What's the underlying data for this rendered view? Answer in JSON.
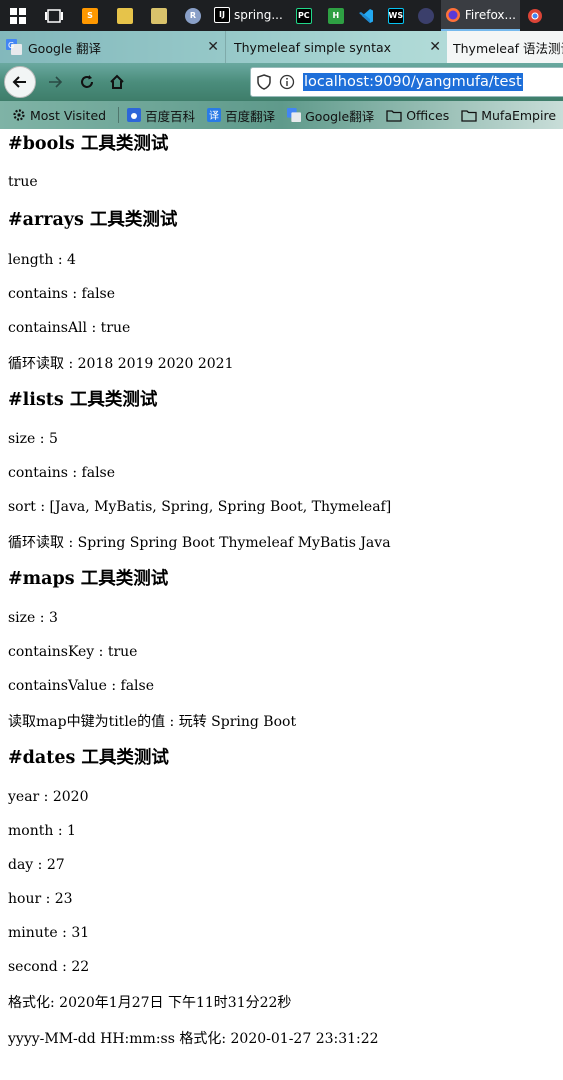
{
  "taskbar": {
    "apps": [
      {
        "name": "start-button",
        "icon": "windows-icon"
      },
      {
        "name": "task-view-button",
        "icon": "task-view-icon"
      },
      {
        "name": "sublime-app",
        "icon": "sublime-icon"
      },
      {
        "name": "notepad-app",
        "icon": "notepad-icon"
      },
      {
        "name": "paint-app",
        "icon": "paint-icon"
      },
      {
        "name": "r-app",
        "icon": "r-icon"
      }
    ],
    "intellij_label": "spring...",
    "firefox_label": "Firefox...",
    "colors": {
      "bg": "#1d1f22",
      "active": "#3a3d42",
      "accent": "#76b9ed"
    }
  },
  "tabs": [
    {
      "label": "Google 翻译",
      "icon": "google-translate-icon"
    },
    {
      "label": "Thymeleaf simple syntax"
    },
    {
      "label": "Thymeleaf 语法测试"
    }
  ],
  "navbar": {
    "url": "localhost:9090/yangmufa/test"
  },
  "bookmarks": [
    {
      "label": "Most Visited",
      "icon": "gear-icon"
    },
    {
      "label": "百度百科",
      "icon": "baidu-icon"
    },
    {
      "label": "百度翻译",
      "icon": "baidu-translate-icon"
    },
    {
      "label": "Google翻译",
      "icon": "google-translate-icon"
    },
    {
      "label": "Offices",
      "icon": "folder-icon"
    },
    {
      "label": "MufaEmpire",
      "icon": "folder-icon"
    }
  ],
  "content": {
    "bools": {
      "heading": "#bools 工具类测试",
      "lines": [
        "true"
      ]
    },
    "arrays": {
      "heading": "#arrays 工具类测试",
      "lines": [
        "length : 4",
        "contains : false",
        "containsAll : true",
        "循环读取 : 2018 2019 2020 2021"
      ]
    },
    "lists": {
      "heading": "#lists 工具类测试",
      "lines": [
        "size : 5",
        "contains : false",
        "sort : [Java, MyBatis, Spring, Spring Boot, Thymeleaf]",
        "循环读取 : Spring Spring Boot Thymeleaf MyBatis Java"
      ]
    },
    "maps": {
      "heading": "#maps 工具类测试",
      "lines": [
        "size : 3",
        "containsKey : true",
        "containsValue : false",
        "读取map中键为title的值 : 玩转 Spring Boot"
      ]
    },
    "dates": {
      "heading": "#dates 工具类测试",
      "lines": [
        "year : 2020",
        "month : 1",
        "day : 27",
        "hour : 23",
        "minute : 31",
        "second : 22",
        "格式化: 2020年1月27日 下午11时31分22秒",
        "yyyy-MM-dd HH:mm:ss 格式化: 2020-01-27 23:31:22"
      ]
    }
  }
}
